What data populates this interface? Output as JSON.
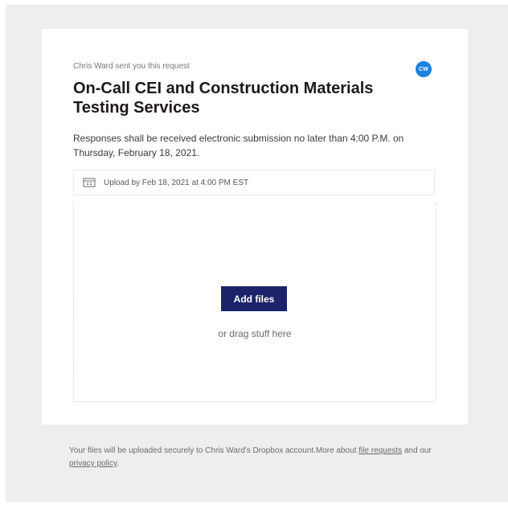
{
  "request": {
    "sender_line": "Chris Ward sent you this request",
    "avatar_initials": "CW",
    "title": "On-Call CEI and Construction Materials Testing Services",
    "description": "Responses shall be received electronic submission  no later than 4:00 P.M. on Thursday, February 18, 2021.",
    "deadline": "Upload by Feb 18, 2021 at 4:00 PM EST",
    "calendar_icon": "calendar-icon"
  },
  "dropzone": {
    "add_button_label": "Add files",
    "drag_hint": "or drag stuff here"
  },
  "footer": {
    "text_before": "Your files will be uploaded securely to Chris Ward's Dropbox account.More about ",
    "link_file_requests": "file requests",
    "text_middle": " and our ",
    "link_privacy": "privacy policy",
    "text_after": "."
  },
  "colors": {
    "accent_blue": "#1a82e2",
    "button_navy": "#1c2369",
    "page_background": "#eeeeee"
  }
}
